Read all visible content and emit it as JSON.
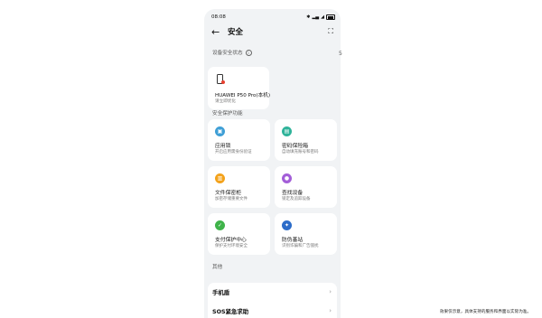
{
  "status_bar": {
    "time": "08:08",
    "icons": [
      "bluetooth-icon",
      "nfc-icon",
      "signal-icon",
      "wifi-icon",
      "battery-icon"
    ]
  },
  "header": {
    "title": "安全",
    "back_icon": "arrow-left-icon",
    "scan_icon": "scan-icon"
  },
  "device_status": {
    "label": "设备安全状态",
    "device_name": "HUAWEI P50 Pro(本机)",
    "device_sub": "请立即优化"
  },
  "protection": {
    "label": "安全保护功能",
    "items": [
      {
        "title": "应用锁",
        "sub": "开启应用需身份验证",
        "icon": "lock-icon",
        "color": "#3f9fd6"
      },
      {
        "title": "密码保险箱",
        "sub": "自动填充账号和密码",
        "icon": "briefcase-icon",
        "color": "#2fb39a"
      },
      {
        "title": "文件保密柜",
        "sub": "加密存储重要文件",
        "icon": "folder-lock-icon",
        "color": "#f3a21b"
      },
      {
        "title": "查找设备",
        "sub": "锁定及追踪设备",
        "icon": "location-icon",
        "color": "#a35ed8"
      },
      {
        "title": "支付保护中心",
        "sub": "保护支付环境安全",
        "icon": "shield-check-icon",
        "color": "#3fb34a"
      },
      {
        "title": "防伪基站",
        "sub": "识别诈骗和广告骚扰",
        "icon": "tower-icon",
        "color": "#2c6cc9"
      }
    ]
  },
  "other": {
    "label": "其他",
    "items": [
      {
        "label": "手机盾"
      },
      {
        "label": "SOS紧急求助"
      }
    ]
  },
  "edge_mark": "5",
  "disclaimer": "效果仅示意，具体支持的服务和界面以实际为准。"
}
